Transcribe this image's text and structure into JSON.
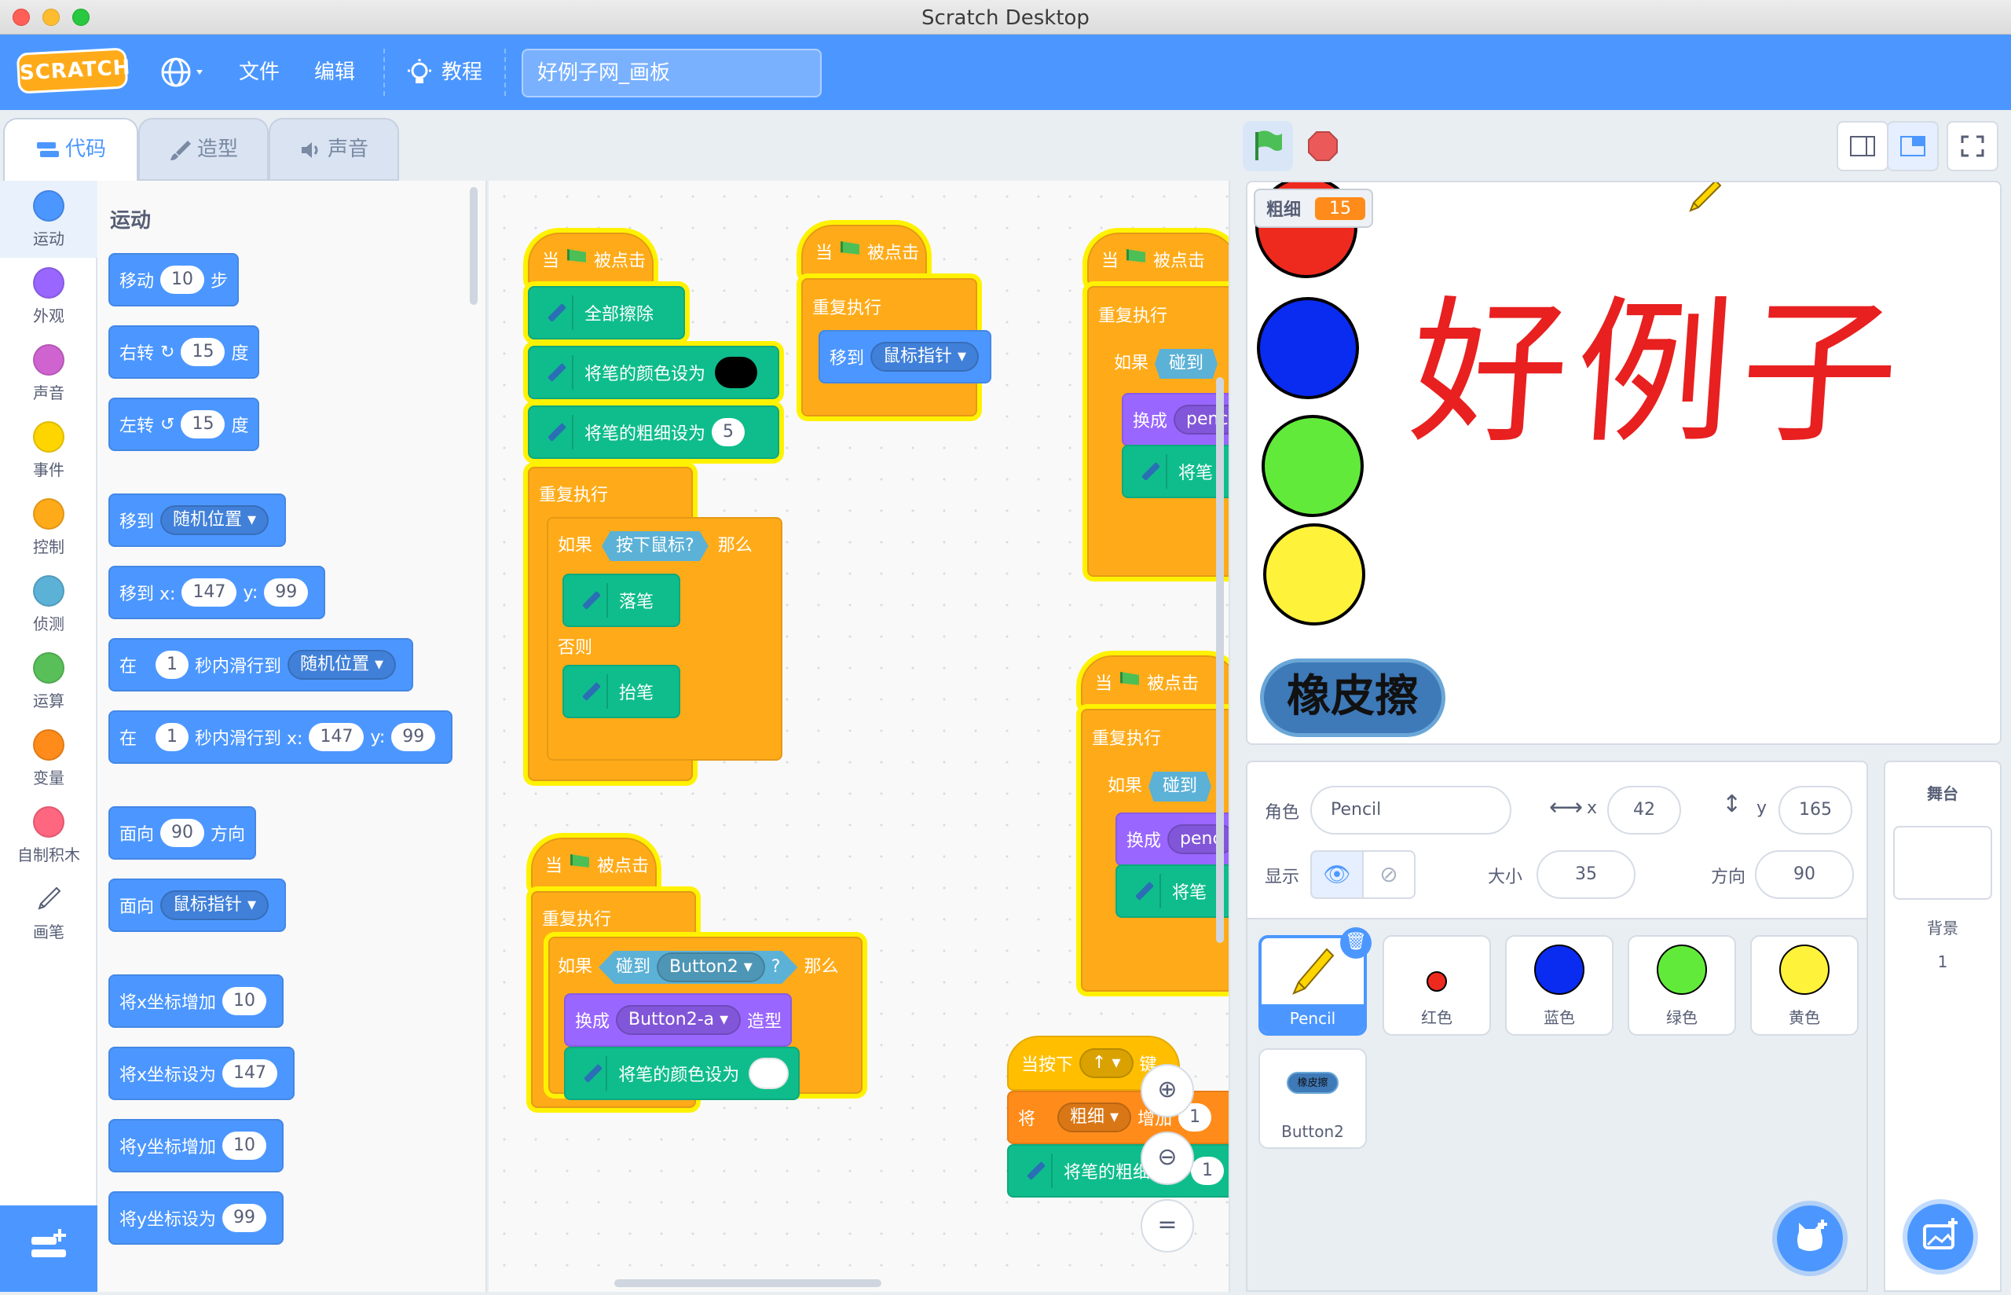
{
  "window": {
    "title": "Scratch Desktop"
  },
  "menubar": {
    "logo_text": "SCRATCH",
    "file": "文件",
    "edit": "编辑",
    "tutorials": "教程",
    "project_title": "好例子网_画板"
  },
  "tabs": {
    "code": "代码",
    "costumes": "造型",
    "sounds": "声音"
  },
  "categories": [
    {
      "label": "运动",
      "color": "#4c97ff"
    },
    {
      "label": "外观",
      "color": "#9966ff"
    },
    {
      "label": "声音",
      "color": "#cf63cf"
    },
    {
      "label": "事件",
      "color": "#ffd500"
    },
    {
      "label": "控制",
      "color": "#ffab19"
    },
    {
      "label": "侦测",
      "color": "#5cb1d6"
    },
    {
      "label": "运算",
      "color": "#59c059"
    },
    {
      "label": "变量",
      "color": "#ff8c1a"
    },
    {
      "label": "自制积木",
      "color": "#ff6680"
    },
    {
      "label": "画笔",
      "color": "#0fbd8c"
    }
  ],
  "palette": {
    "title": "运动",
    "move": {
      "a": "移动",
      "n": "10",
      "b": "步"
    },
    "turn_right": {
      "a": "右转",
      "n": "15",
      "b": "度"
    },
    "turn_left": {
      "a": "左转",
      "n": "15",
      "b": "度"
    },
    "goto": {
      "a": "移到",
      "dd": "随机位置"
    },
    "goto_xy": {
      "a": "移到 x:",
      "x": "147",
      "b": "y:",
      "y": "99"
    },
    "glide": {
      "a": "在",
      "n": "1",
      "b": "秒内滑行到",
      "dd": "随机位置"
    },
    "glide_xy": {
      "a": "在",
      "n": "1",
      "b": "秒内滑行到 x:",
      "x": "147",
      "c": "y:",
      "y": "99"
    },
    "point_dir": {
      "a": "面向",
      "n": "90",
      "b": "方向"
    },
    "point_towards": {
      "a": "面向",
      "dd": "鼠标指针"
    },
    "change_x": {
      "a": "将x坐标增加",
      "n": "10"
    },
    "set_x": {
      "a": "将x坐标设为",
      "n": "147"
    },
    "change_y": {
      "a": "将y坐标增加",
      "n": "10"
    },
    "set_y": {
      "a": "将y坐标设为",
      "n": "99"
    }
  },
  "scripts": {
    "when_flag": "当",
    "clicked": "被点击",
    "clear": "全部擦除",
    "set_pen_color": "将笔的颜色设为",
    "set_pen_size": "将笔的粗细设为",
    "pen_size_value": "5",
    "forever": "重复执行",
    "if": "如果",
    "mouse_down": "按下鼠标?",
    "then": "那么",
    "pen_down": "落笔",
    "else": "否则",
    "pen_up": "抬笔",
    "goto": "移到",
    "mouse_pointer": "鼠标指针",
    "touching": "碰到",
    "button2": "Button2",
    "q": "?",
    "switch_costume": "换成",
    "costume_name": "Button2-a",
    "costume": "造型",
    "partial_touch": "碰到",
    "partial_switch": "换成",
    "partial_pen": "penci",
    "partial_pen2": "penc",
    "partial_set": "将笔",
    "when_key": "当按下",
    "key": "↑",
    "key_suffix": "键",
    "var_set": "将",
    "var_name": "粗细",
    "change_by": "增加",
    "change_value": "1",
    "pen_size_change": "将笔的粗细增加",
    "pen_size_change_value": "1"
  },
  "stage": {
    "monitor_label": "粗细",
    "monitor_value": "15",
    "drawn_text": "好例子",
    "eraser_label": "橡皮擦"
  },
  "sprite_info": {
    "sprite_label": "角色",
    "sprite_name": "Pencil",
    "x_label": "x",
    "x_value": "42",
    "y_label": "y",
    "y_value": "165",
    "show_label": "显示",
    "size_label": "大小",
    "size_value": "35",
    "direction_label": "方向",
    "direction_value": "90"
  },
  "sprites": [
    {
      "name": "Pencil",
      "color": "#ffd500"
    },
    {
      "name": "红色",
      "color": "#ee2a1e"
    },
    {
      "name": "蓝色",
      "color": "#0a2bf0"
    },
    {
      "name": "绿色",
      "color": "#62ea3b"
    },
    {
      "name": "黄色",
      "color": "#fff23a"
    },
    {
      "name": "Button2",
      "color": "#3e79b8"
    }
  ],
  "button2_thumb_text": "橡皮擦",
  "stage_panel": {
    "title": "舞台",
    "backdrops_label": "背景",
    "backdrops_count": "1"
  }
}
